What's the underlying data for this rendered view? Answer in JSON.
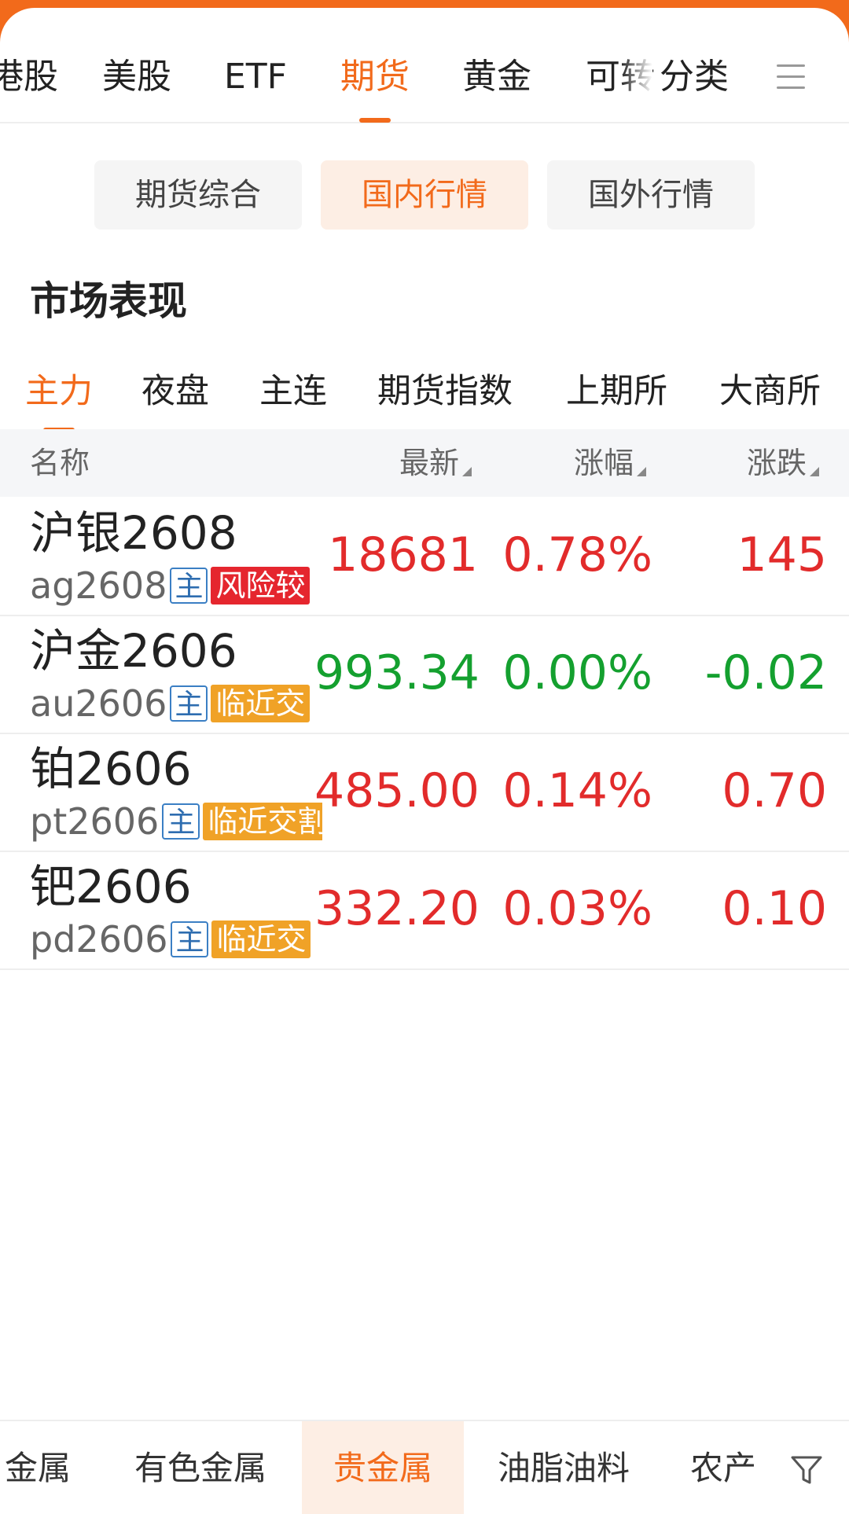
{
  "top_tabs": [
    "港股",
    "美股",
    "ETF",
    "期货",
    "黄金",
    "可转",
    "分类"
  ],
  "segments": [
    "期货综合",
    "国内行情",
    "国外行情"
  ],
  "section_title": "市场表现",
  "sub_tabs": [
    "主力",
    "夜盘",
    "主连",
    "期货指数",
    "上期所",
    "大商所"
  ],
  "table": {
    "headers": {
      "name": "名称",
      "last": "最新",
      "pct": "涨幅",
      "chg": "涨跌"
    },
    "main_badge": "主",
    "rows": [
      {
        "name": "沪银2608",
        "code": "ag2608",
        "tag": "风险较",
        "last": "18681",
        "pct": "0.78%",
        "chg": "145"
      },
      {
        "name": "沪金2606",
        "code": "au2606",
        "tag": "临近交",
        "last": "993.34",
        "pct": "0.00%",
        "chg": "-0.02"
      },
      {
        "name": "铂2606",
        "code": "pt2606",
        "tag": "临近交割",
        "last": "485.00",
        "pct": "0.14%",
        "chg": "0.70"
      },
      {
        "name": "钯2606",
        "code": "pd2606",
        "tag": "临近交",
        "last": "332.20",
        "pct": "0.03%",
        "chg": "0.10"
      }
    ]
  },
  "bottom_tabs": [
    "金属",
    "有色金属",
    "贵金属",
    "油脂油料",
    "农产"
  ],
  "colors": {
    "accent": "#f26a1b",
    "up": "#e22b2b",
    "flat": "#14a02f",
    "risk_tag": "#e5262e",
    "warn_tag": "#f0a227"
  },
  "icons": {
    "menu": "menu-icon",
    "filter": "filter-icon"
  }
}
